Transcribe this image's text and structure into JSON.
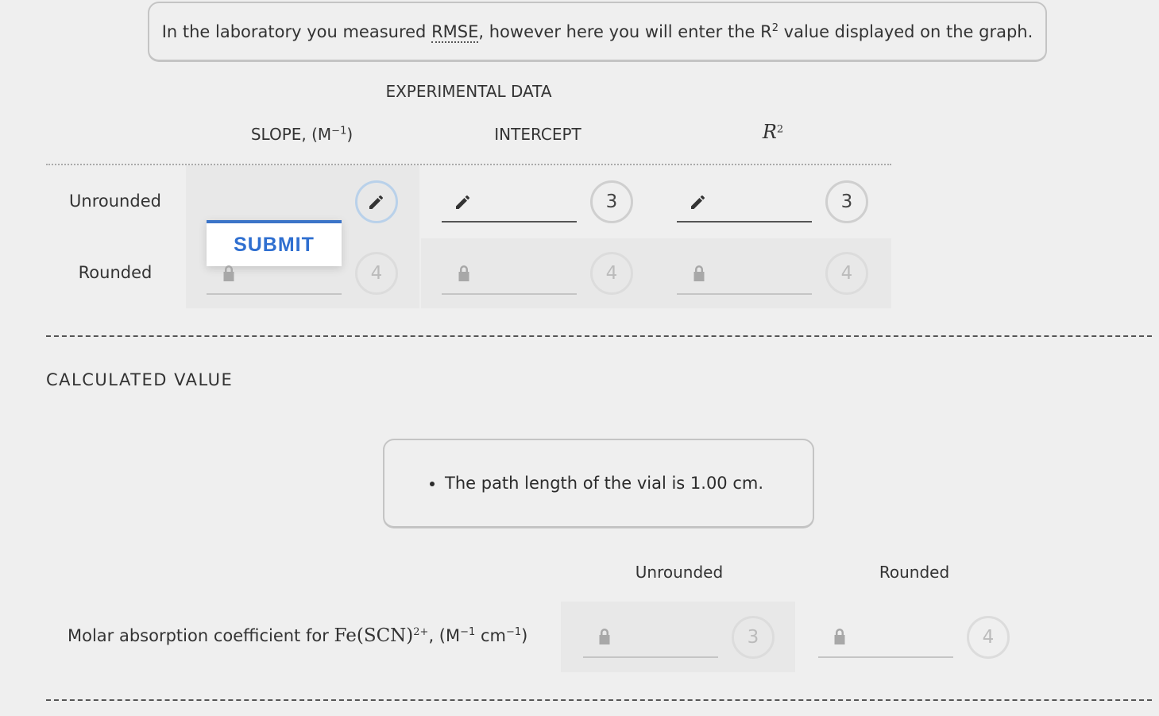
{
  "notice": {
    "before": "In the laboratory you measured",
    "abbr": "RMSE",
    "middle": ", however here you will enter the R",
    "sup": "2",
    "after": " value displayed on the graph."
  },
  "experimental": {
    "title": "EXPERIMENTAL DATA",
    "columns": {
      "slope_label": "SLOPE, (M",
      "slope_sup": "−1",
      "slope_close": ")",
      "intercept_label": "INTERCEPT",
      "r2_base": "R",
      "r2_sup": "2"
    },
    "rows": {
      "unrounded_label": "Unrounded",
      "rounded_label": "Rounded"
    },
    "badges": {
      "intercept_unrounded": "3",
      "r2_unrounded": "3",
      "slope_rounded": "4",
      "intercept_rounded": "4",
      "r2_rounded": "4"
    },
    "submit_label": "SUBMIT"
  },
  "calculated": {
    "title": "CALCULATED VALUE",
    "hint": "The path length of the vial is 1.00 cm.",
    "col_unrounded": "Unrounded",
    "col_rounded": "Rounded",
    "row_label_prefix": "Molar absorption coefficient for ",
    "formula": "Fe(SCN)",
    "formula_sup": "2+",
    "units_a": ", (M",
    "units_a_sup": "−1",
    "units_b": " cm",
    "units_b_sup": "−1",
    "units_close": ")",
    "badge_unrounded": "3",
    "badge_rounded": "4"
  },
  "icons": {
    "edit": "pencil-icon",
    "locked": "lock-icon"
  },
  "colors": {
    "submit_accent": "#3b74c8",
    "background": "#efefef",
    "cell": "#e8e8e8"
  }
}
